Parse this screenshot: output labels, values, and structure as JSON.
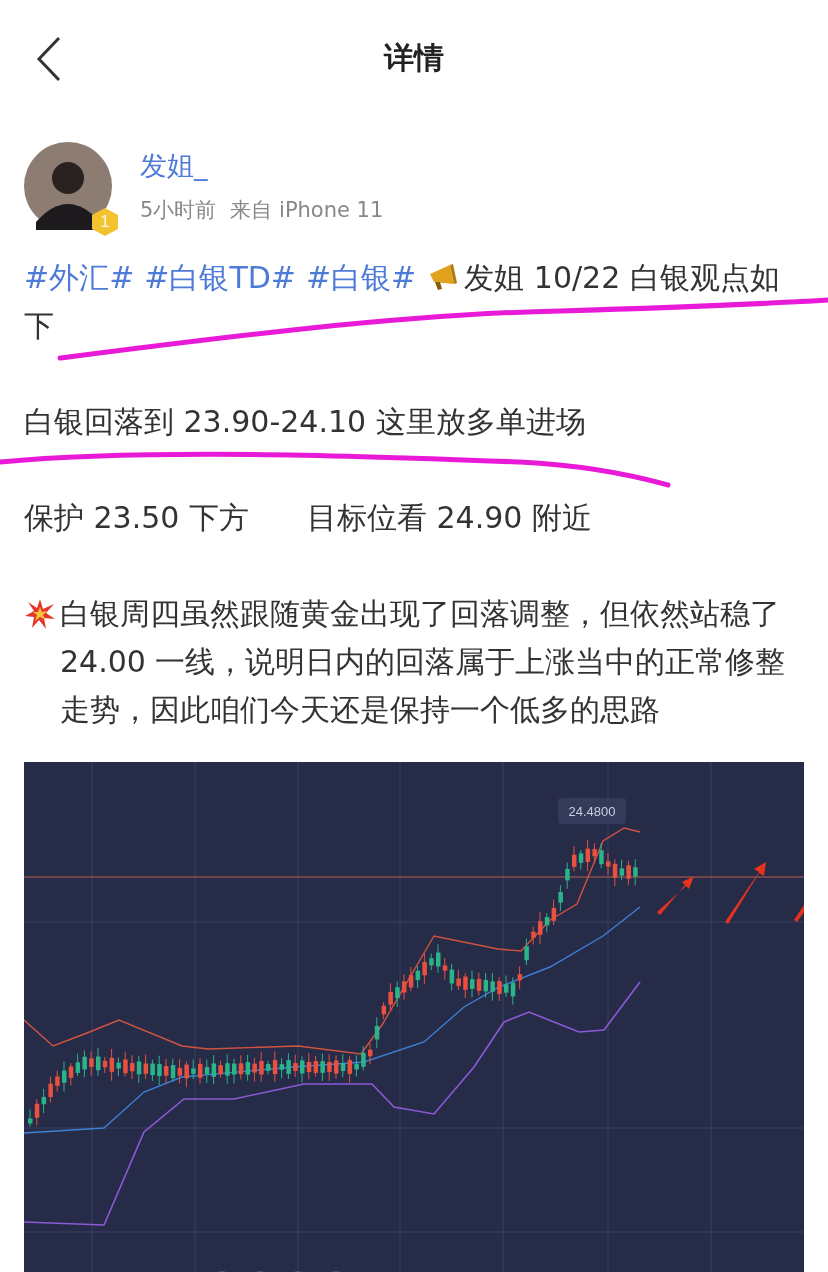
{
  "nav": {
    "title": "详情"
  },
  "author": {
    "name": "发姐_",
    "level": "1",
    "time": "5小时前",
    "source": "来自 iPhone 11"
  },
  "intro": [
    {
      "kind": "tag",
      "text": "#外汇#"
    },
    {
      "kind": "tag",
      "text": "#白银TD#"
    },
    {
      "kind": "tag",
      "text": "#白银#"
    },
    {
      "kind": "megaphone"
    },
    {
      "kind": "text",
      "text": "发姐 10/22 白银观点如下"
    }
  ],
  "entry": "白银回落到 23.90-24.10 这里放多单进场",
  "stop": "保护 23.50 下方",
  "target": "目标位看 24.90 附近",
  "analysis": "白银周四虽然跟随黄金出现了回落调整，但依然站稳了 24.00 一线，说明日内的回落属于上涨当中的正常修整走势，因此咱们今天还是保持一个低多的思路",
  "chart_image": {
    "price_label": "24.4800"
  }
}
